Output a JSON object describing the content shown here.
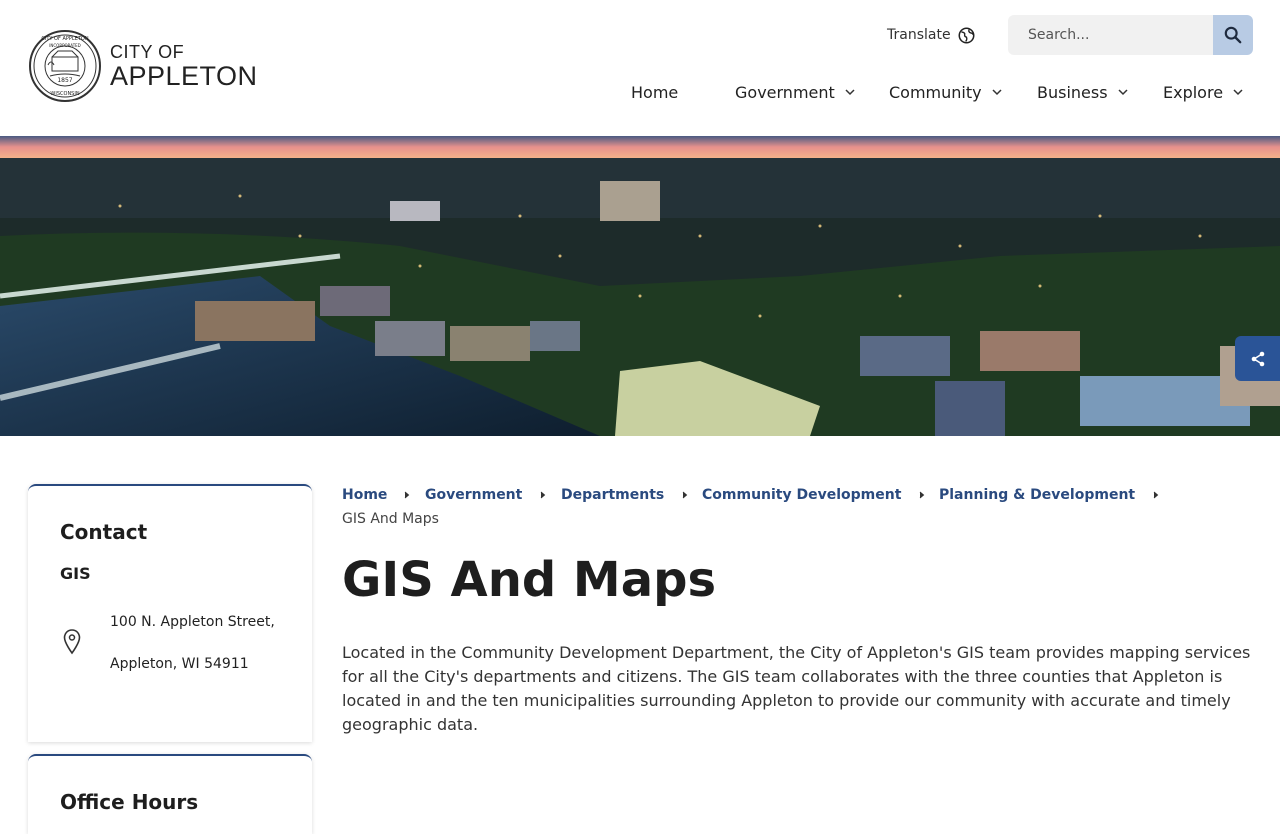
{
  "header": {
    "logo": {
      "line1": "CITY OF",
      "line2": "APPLETON",
      "seal_text_top": "CITY OF APPLETON",
      "seal_text_mid": "INCORPORATED",
      "seal_text_bottom": "WISCONSIN",
      "seal_year": "1857"
    },
    "translate_label": "Translate",
    "search": {
      "placeholder": "Search..."
    },
    "nav": [
      {
        "label": "Home"
      },
      {
        "label": "Government"
      },
      {
        "label": "Community"
      },
      {
        "label": "Business"
      },
      {
        "label": "Explore"
      }
    ]
  },
  "sidebar": {
    "contact": {
      "title": "Contact",
      "subtitle": "GIS",
      "address_line1": "100 N. Appleton Street,",
      "address_line2": "Appleton, WI 54911"
    },
    "office_hours": {
      "title": "Office Hours"
    }
  },
  "breadcrumb": {
    "items": [
      {
        "label": "Home"
      },
      {
        "label": "Government"
      },
      {
        "label": "Departments"
      },
      {
        "label": "Community Development"
      },
      {
        "label": "Planning & Development"
      }
    ],
    "current": "GIS And Maps"
  },
  "main": {
    "title": "GIS And Maps",
    "body": "Located in the Community Development Department, the City of Appleton's GIS team provides mapping services for all the City's departments and citizens. The GIS team collaborates with the three counties that Appleton is located in and the ten municipalities surrounding Appleton to provide our community with accurate and timely geographic data."
  },
  "colors": {
    "link": "#2a4a7f",
    "share_button": "#2a5497",
    "search_button": "#b8cbe4"
  },
  "icons": [
    "globe-icon",
    "search-icon",
    "chevron-down-icon",
    "share-icon",
    "map-pin-icon",
    "chevron-right-icon"
  ]
}
